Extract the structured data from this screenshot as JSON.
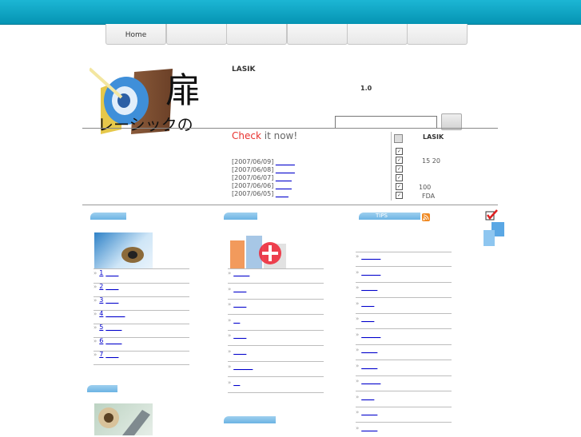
{
  "nav": {
    "tabs": [
      "Home",
      "",
      "",
      "",
      "",
      ""
    ]
  },
  "header": {
    "logo_text": "扉 レーシックの",
    "site_label": "LASIK",
    "version": "1.0",
    "search_value": ""
  },
  "news": {
    "check_red": "Check",
    "check_rest": " it now!",
    "items": [
      {
        "date": "[2007/06/09]",
        "link": "______"
      },
      {
        "date": "[2007/06/08]",
        "link": "______"
      },
      {
        "date": "[2007/06/07]",
        "link": "_____"
      },
      {
        "date": "[2007/06/06]",
        "link": "_____"
      },
      {
        "date": "[2007/06/05]",
        "link": "____"
      }
    ]
  },
  "infobox": {
    "title": "LASIK",
    "rows": [
      "",
      "15  20",
      "",
      "",
      "100",
      "FDA"
    ]
  },
  "columns": {
    "left": {
      "links": [
        "1",
        "2",
        "3",
        "4",
        "5",
        "6",
        "7"
      ]
    },
    "middle": {
      "links": [
        "",
        "",
        "",
        "",
        "",
        "",
        "",
        ""
      ]
    },
    "right": {
      "header": "TIPS",
      "links": [
        "",
        "",
        "",
        "",
        "",
        "",
        "",
        "",
        "",
        "",
        "",
        ""
      ]
    }
  },
  "colors": {
    "topbar": "#0aa3c4",
    "section_tab": "#7dbde8",
    "link": "#0000cc",
    "check_red": "#e8322f"
  }
}
